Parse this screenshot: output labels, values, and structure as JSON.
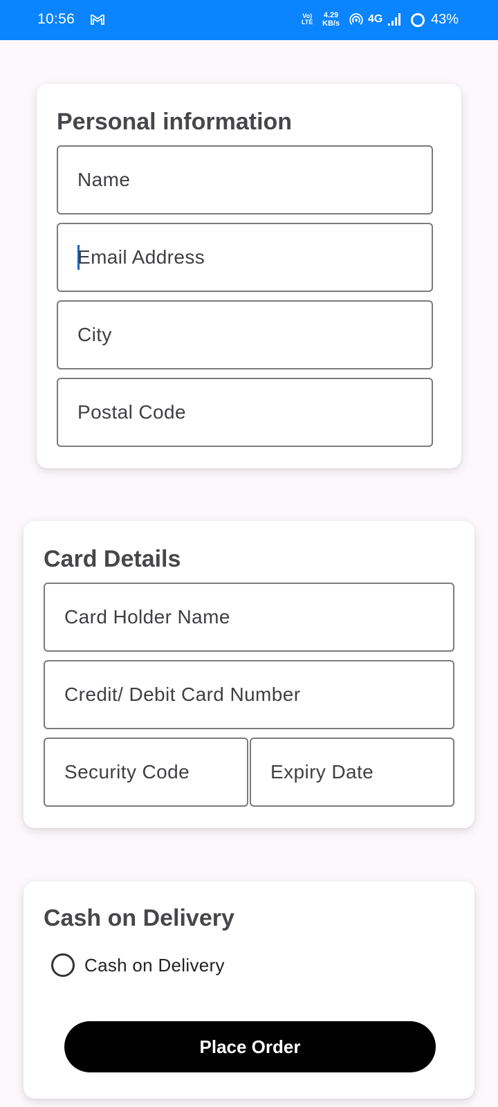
{
  "status_bar": {
    "time": "10:56",
    "volte_top": "Vo)",
    "volte_bottom": "LTE",
    "speed_value": "4.29",
    "speed_unit": "KB/s",
    "network": "4G",
    "battery": "43%",
    "background_color": "#0a84ff"
  },
  "personal_info": {
    "title": "Personal information",
    "fields": [
      {
        "placeholder": "Name",
        "value": ""
      },
      {
        "placeholder": "Email Address",
        "value": "",
        "focused": true
      },
      {
        "placeholder": "City",
        "value": ""
      },
      {
        "placeholder": "Postal Code",
        "value": ""
      }
    ]
  },
  "card_details": {
    "title": "Card Details",
    "fields": [
      {
        "placeholder": "Card Holder Name",
        "value": ""
      },
      {
        "placeholder": "Credit/ Debit Card Number",
        "value": ""
      },
      {
        "placeholder": "Security Code",
        "value": ""
      },
      {
        "placeholder": "Expiry Date",
        "value": ""
      }
    ]
  },
  "cash_on_delivery": {
    "title": "Cash on Delivery",
    "option_label": "Cash on Delivery",
    "option_selected": false,
    "button_label": "Place Order"
  },
  "colors": {
    "accent_caret": "#1565c0",
    "button": "#000000",
    "page_background": "#fcf8fb"
  },
  "icons": {
    "status_bar": [
      "gmail-icon",
      "hotspot-icon",
      "signal-icon",
      "battery-icon"
    ]
  }
}
